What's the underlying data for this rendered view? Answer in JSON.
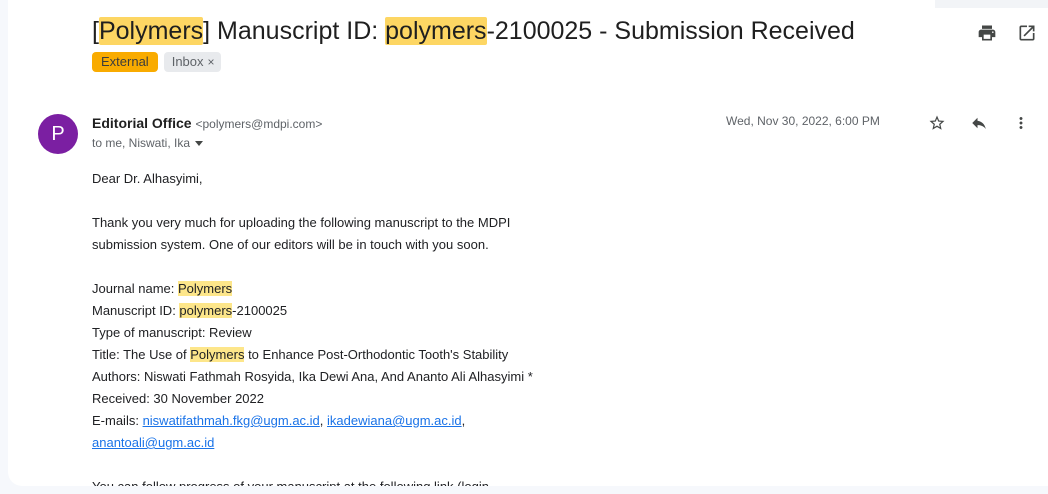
{
  "subject": {
    "prefix_open": "[",
    "journal": "Polymers",
    "prefix_close": "] Manuscript ID: ",
    "id_highlight": "polymers",
    "id_rest": "-2100025 - Submission Received"
  },
  "labels": {
    "external": "External",
    "inbox": "Inbox",
    "inbox_remove": "×"
  },
  "toolbar": {
    "print_icon": "print-icon",
    "open_new_window_icon": "open-in-new-window-icon"
  },
  "message": {
    "avatar_initial": "P",
    "sender_name": "Editorial Office",
    "sender_email": "<polymers@mdpi.com>",
    "recipients": "to me, Niswati, Ika",
    "date": "Wed, Nov 30, 2022, 6:00 PM",
    "actions": [
      "star-icon",
      "reply-icon",
      "more-vert-icon"
    ]
  },
  "body": {
    "greeting": "Dear Dr. Alhasyimi,",
    "para1_line1": "Thank you very much for uploading the following manuscript to the MDPI",
    "para1_line2": "submission system. One of our editors will be in touch with you soon.",
    "journal_label": "Journal name: ",
    "journal_value": "Polymers",
    "msid_label": "Manuscript ID: ",
    "msid_highlight": "polymers",
    "msid_rest": "-2100025",
    "type_line": "Type of manuscript: Review",
    "title_label": "Title: The Use of ",
    "title_highlight": "Polymers",
    "title_rest": " to Enhance Post-Orthodontic Tooth's Stability",
    "authors_line": "Authors: Niswati Fathmah Rosyida, Ika Dewi Ana, And Ananto Ali Alhasyimi *",
    "received_line": "Received: 30 November 2022",
    "emails_label": "E-mails: ",
    "email1": "niswatifathmah.fkg@ugm.ac.id",
    "email_sep": ", ",
    "email2": "ikadewiana@ugm.ac.id",
    "email_trail": ",",
    "email3": "anantoali@ugm.ac.id",
    "follow_line": "You can follow progress of your manuscript at the following link (login"
  }
}
